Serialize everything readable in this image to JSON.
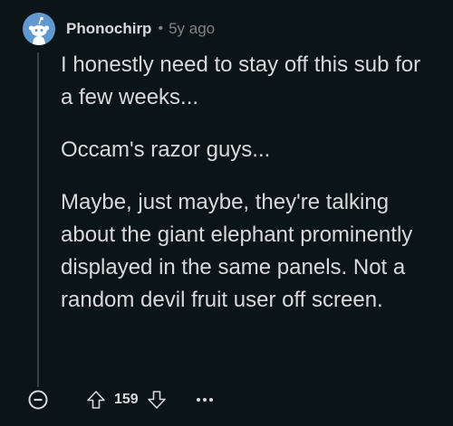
{
  "comment": {
    "author": "Phonochirp",
    "separator": "•",
    "age": "5y ago",
    "paragraphs": [
      "I honestly need to stay off this sub for a few weeks...",
      "Occam's razor guys...",
      "Maybe, just maybe, they're talking about the giant elephant prominently displayed in the same panels. Not a random devil fruit user off screen."
    ],
    "score": "159"
  },
  "icons": {
    "avatar": "snoo-avatar-icon",
    "collapse": "collapse-minus-icon",
    "upvote": "upvote-arrow-icon",
    "downvote": "downvote-arrow-icon",
    "more": "more-options-icon"
  },
  "colors": {
    "background": "#0b1416",
    "text": "#d7dadc",
    "muted": "#818384",
    "avatar_bg": "#5f99cf",
    "thread_line": "#3a3f42"
  }
}
